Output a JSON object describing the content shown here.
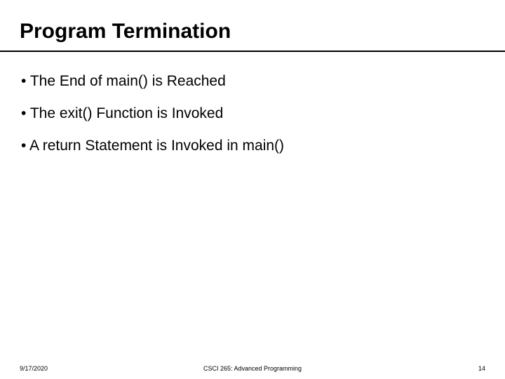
{
  "slide": {
    "title": "Program Termination",
    "bullets": [
      "The End of main() is Reached",
      "The exit() Function is Invoked",
      "A return Statement is Invoked in main()"
    ]
  },
  "footer": {
    "date": "9/17/2020",
    "course": "CSCI 265: Advanced Programming",
    "page_number": "14"
  }
}
